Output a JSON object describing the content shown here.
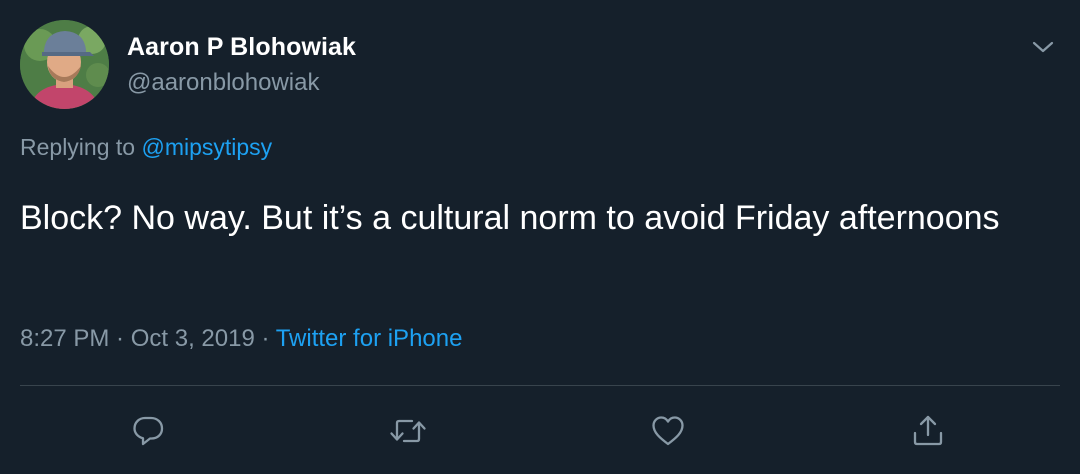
{
  "tweet": {
    "author": {
      "display_name": "Aaron P Blohowiak",
      "handle": "@aaronblohowiak",
      "avatar_icon": "avatar-photo"
    },
    "replying_to": {
      "prefix": "Replying to ",
      "mention": "@mipsytipsy"
    },
    "text": "Block? No way. But it’s a cultural norm to avoid Friday afternoons",
    "meta": {
      "time": "8:27 PM",
      "separator": " · ",
      "date": "Oct 3, 2019",
      "source": "Twitter for iPhone"
    },
    "menu_icon": "chevron-down-icon",
    "actions": [
      {
        "name": "reply",
        "icon": "speech-bubble-icon"
      },
      {
        "name": "retweet",
        "icon": "retweet-icon"
      },
      {
        "name": "like",
        "icon": "heart-icon"
      },
      {
        "name": "share",
        "icon": "share-icon"
      }
    ]
  },
  "colors": {
    "background": "#15202b",
    "primary_text": "#ffffff",
    "secondary_text": "#8899a6",
    "accent": "#1da1f2",
    "divider": "#38444d"
  }
}
